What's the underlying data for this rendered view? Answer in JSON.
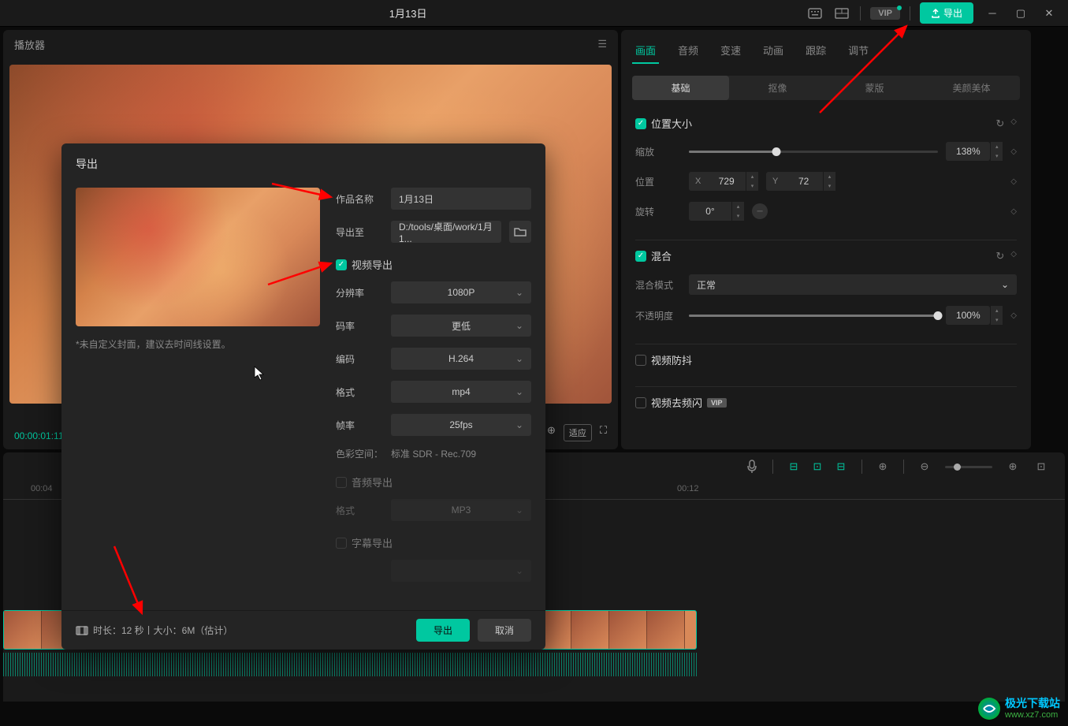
{
  "topbar": {
    "title": "1月13日",
    "export_label": "导出"
  },
  "player": {
    "title": "播放器",
    "time": "00:00:01:11",
    "adapt": "适应"
  },
  "properties": {
    "tabs": [
      "画面",
      "音频",
      "变速",
      "动画",
      "跟踪",
      "调节"
    ],
    "subtabs": [
      "基础",
      "抠像",
      "蒙版",
      "美颜美体"
    ],
    "position_size": {
      "title": "位置大小",
      "scale_label": "缩放",
      "scale_value": "138%",
      "position_label": "位置",
      "x_value": "729",
      "y_value": "72",
      "rotate_label": "旋转",
      "rotate_value": "0°"
    },
    "blend": {
      "title": "混合",
      "mode_label": "混合模式",
      "mode_value": "正常",
      "opacity_label": "不透明度",
      "opacity_value": "100%"
    },
    "stabilize": {
      "label": "视频防抖"
    },
    "deflicker": {
      "label": "视频去频闪"
    }
  },
  "ruler": {
    "marks": [
      "00:04",
      "00:12"
    ]
  },
  "export_dialog": {
    "title": "导出",
    "name_label": "作品名称",
    "name_value": "1月13日",
    "path_label": "导出至",
    "path_value": "D:/tools/桌面/work/1月1...",
    "video_section": "视频导出",
    "resolution_label": "分辨率",
    "resolution_value": "1080P",
    "bitrate_label": "码率",
    "bitrate_value": "更低",
    "codec_label": "编码",
    "codec_value": "H.264",
    "format_label": "格式",
    "format_value": "mp4",
    "fps_label": "帧率",
    "fps_value": "25fps",
    "colorspace_label": "色彩空间：",
    "colorspace_value": "标准 SDR - Rec.709",
    "audio_section": "音频导出",
    "audio_format_label": "格式",
    "audio_format_value": "MP3",
    "subtitle_section": "字幕导出",
    "hint": "*未自定义封面，建议去时间线设置。",
    "footer_info": "时长：12 秒丨大小：6M（估计）",
    "export_btn": "导出",
    "cancel_btn": "取消"
  },
  "watermark": {
    "cn": "极光下载站",
    "url": "www.xz7.com"
  }
}
